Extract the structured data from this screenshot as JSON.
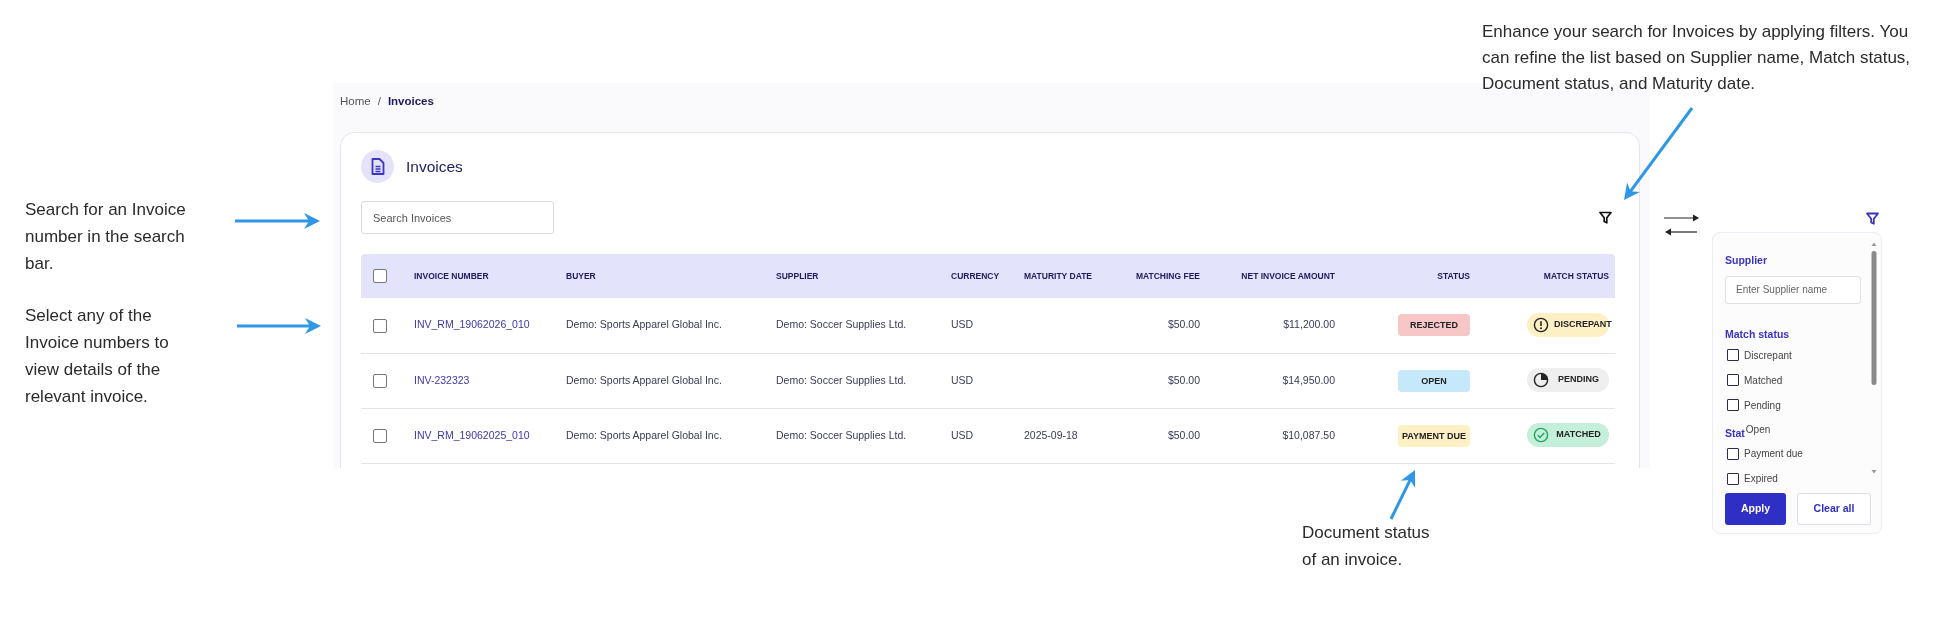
{
  "callouts": [
    {
      "text": "Search for an Invoice number in the search bar."
    },
    {
      "text": "Select any of the Invoice numbers to view details of the relevant invoice."
    },
    {
      "text": "Enhance your search for Invoices by applying filters. You can refine the list based on Supplier name, Match status, Document status, and Maturity date."
    },
    {
      "text": "Document status of an invoice."
    }
  ],
  "breadcrumb": [
    {
      "label": "Home",
      "current": false
    },
    {
      "label": "Invoices",
      "current": true
    }
  ],
  "breadcrumb_separator": "/",
  "page_title": "Invoices",
  "search": {
    "placeholder": "Search Invoices"
  },
  "table": {
    "all_selected": false,
    "columns": [
      "INVOICE NUMBER",
      "BUYER",
      "SUPPLIER",
      "CURRENCY",
      "MATURITY DATE",
      "MATCHING FEE",
      "NET INVOICE AMOUNT",
      "STATUS",
      "MATCH STATUS"
    ],
    "rows": [
      {
        "selected": false,
        "invoice_number": "INV_RM_19062026_010",
        "buyer": "Demo: Sports Apparel Global Inc.",
        "supplier": "Demo: Soccer Supplies Ltd.",
        "currency": "USD",
        "matching_fee": "$50.00",
        "net_invoice_amount": "$11,200.00",
        "status": {
          "text": "REJECTED",
          "kind": "rejected"
        },
        "match_status": {
          "text": "DISCREPANT",
          "kind": "discrepant"
        }
      },
      {
        "selected": false,
        "invoice_number": "INV-232323",
        "buyer": "Demo: Sports Apparel Global Inc.",
        "supplier": "Demo: Soccer Supplies Ltd.",
        "currency": "USD",
        "matching_fee": "$50.00",
        "net_invoice_amount": "$14,950.00",
        "status": {
          "text": "OPEN",
          "kind": "open"
        },
        "match_status": {
          "text": "PENDING",
          "kind": "pending"
        }
      },
      {
        "selected": false,
        "invoice_number": "INV_RM_19062025_010",
        "buyer": "Demo: Sports Apparel Global Inc.",
        "supplier": "Demo: Soccer Supplies Ltd.",
        "currency": "USD",
        "maturity_date": "2025-09-18",
        "matching_fee": "$50.00",
        "net_invoice_amount": "$10,087.50",
        "status": {
          "text": "PAYMENT DUE",
          "kind": "payment_due"
        },
        "match_status": {
          "text": "MATCHED",
          "kind": "matched"
        }
      }
    ]
  },
  "filter_panel": {
    "sections": [
      {
        "title": "Supplier",
        "kind": "text",
        "placeholder": "Enter Supplier name"
      },
      {
        "title": "Match status",
        "kind": "checks",
        "options": [
          {
            "label": "Discrepant",
            "kind": "checkbox",
            "checked": false
          },
          {
            "label": "Matched",
            "kind": "checkbox",
            "checked": false
          },
          {
            "label": "Pending",
            "kind": "checkbox",
            "checked": false
          }
        ]
      },
      {
        "title": "Stat",
        "kind": "checks",
        "options": [
          {
            "label": "Open",
            "kind": "bare"
          },
          {
            "label": "Payment due",
            "kind": "checkbox",
            "checked": false
          },
          {
            "label": "Expired",
            "kind": "checkbox",
            "checked": false
          }
        ]
      }
    ],
    "buttons": [
      {
        "label": "Apply",
        "kind": "primary"
      },
      {
        "label": "Clear all",
        "kind": "outline"
      }
    ]
  }
}
